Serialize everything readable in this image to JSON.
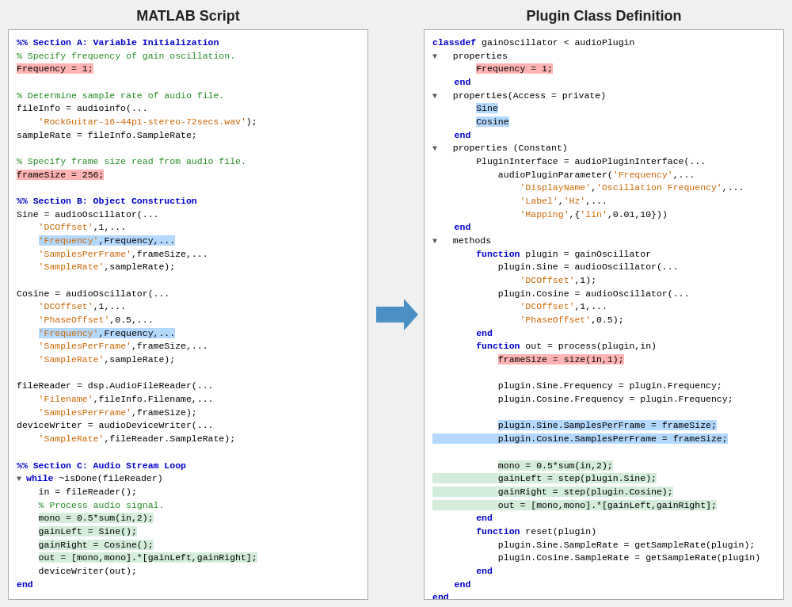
{
  "titles": {
    "left": "MATLAB Script",
    "right": "Plugin Class Definition"
  },
  "arrow": {
    "label": "→"
  }
}
